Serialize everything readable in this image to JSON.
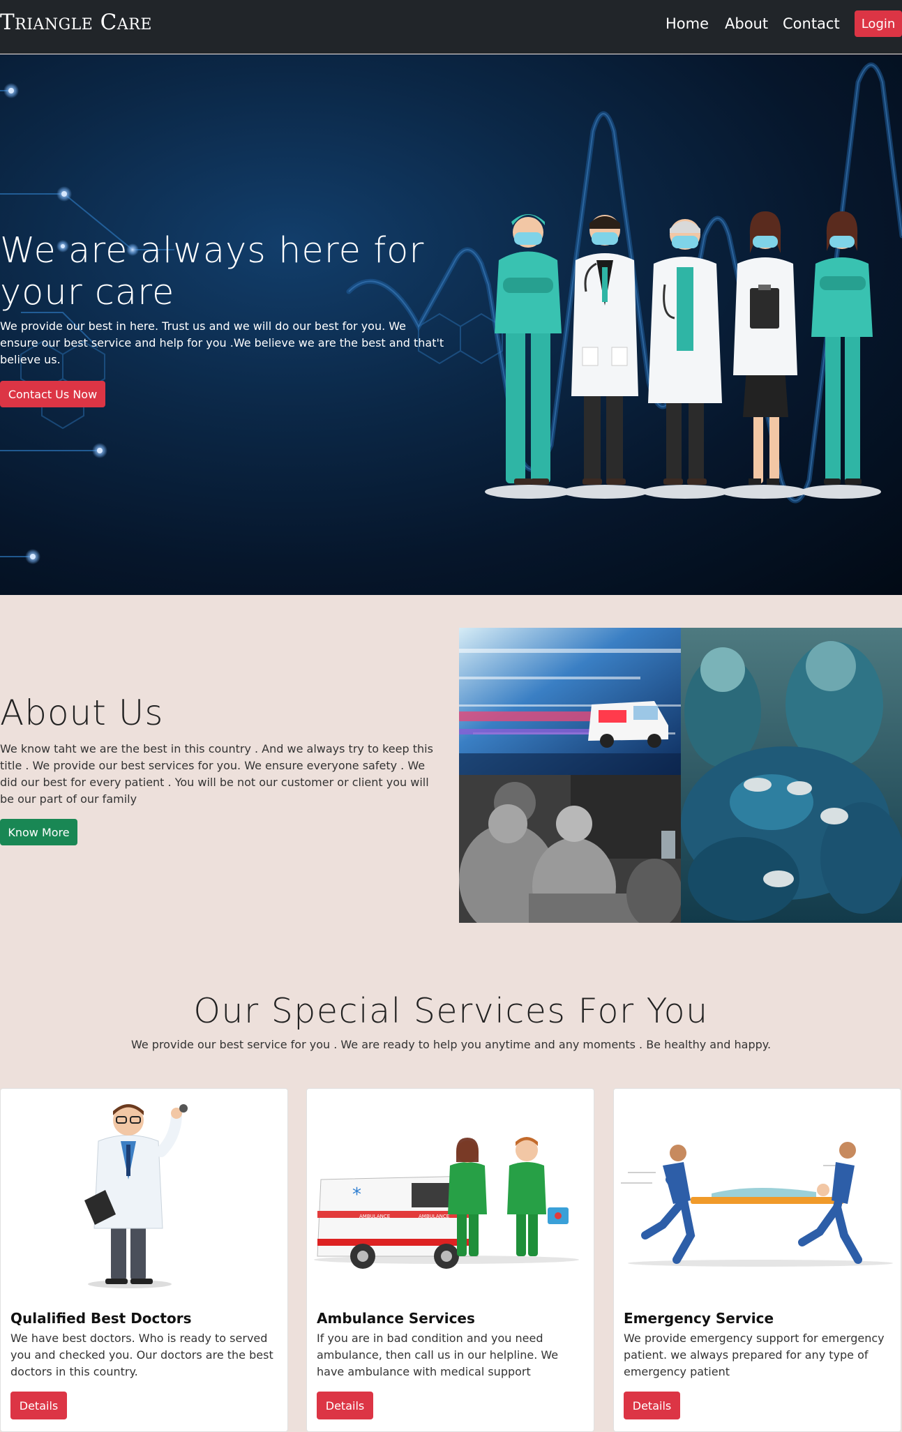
{
  "nav": {
    "brand": "Triangle Care",
    "links": [
      "Home",
      "About",
      "Contact"
    ],
    "login_label": "Login"
  },
  "hero": {
    "title": "We are always here for your care",
    "text": "We provide our best in here. Trust us and we will do our best for you. We ensure our best service and help for you .We believe we are the best and that't believe us.",
    "button_label": "Contact Us Now"
  },
  "about": {
    "title": "About Us",
    "text": "We know taht we are the best in this country . And we always try to keep this title . We provide our best services for you. We ensure everyone safety . We did our best for every patient . You will be not our customer or client you will be our part of our family",
    "button_label": "Know More"
  },
  "services": {
    "title": "Our Special Services For You",
    "subtitle": "We provide our best service for you . We are ready to help you anytime and any moments . Be healthy and happy.",
    "cards": [
      {
        "title": "Qulalified Best Doctors",
        "text": "We have best doctors. Who is ready to served you and checked you. Our doctors are the best doctors in this country.",
        "button_label": "Details"
      },
      {
        "title": "Ambulance Services",
        "text": "If you are in bad condition and you need ambulance, then call us in our helpline. We have ambulance with medical support",
        "button_label": "Details"
      },
      {
        "title": "Emergency Service",
        "text": "We provide emergency support for emergency patient. we always prepared for any type of emergency patient",
        "button_label": "Details"
      }
    ]
  },
  "colors": {
    "navbar": "#212529",
    "danger": "#dc3545",
    "success": "#198754",
    "page_bg": "#ede0db",
    "scrub_teal": "#2fb5a5"
  }
}
